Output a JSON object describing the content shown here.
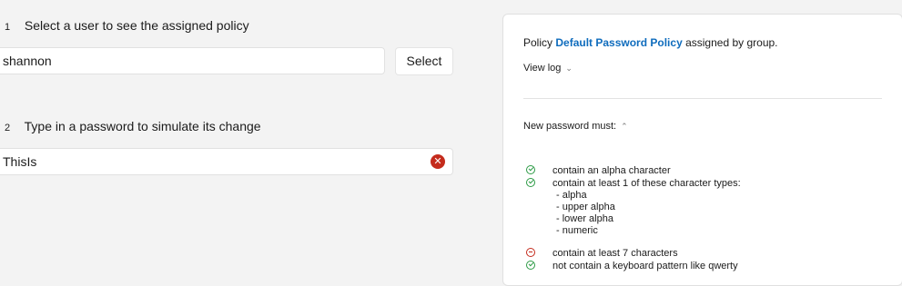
{
  "steps": {
    "one": {
      "num": "1",
      "label": "Select a user to see the assigned policy"
    },
    "two": {
      "num": "2",
      "label": "Type in a password to simulate its change"
    }
  },
  "user_field": {
    "value": "shannon"
  },
  "select_button": {
    "label": "Select"
  },
  "password_field": {
    "value": "ThisIs"
  },
  "panel": {
    "policy_prefix": "Policy",
    "policy_name": "Default Password Policy",
    "policy_suffix": "assigned by group.",
    "view_log": "View log",
    "new_password_must": "New password must:",
    "rules": [
      {
        "text": "contain an alpha character",
        "status": "pass"
      },
      {
        "text": "contain at least 1 of these character types:",
        "status": "pass"
      },
      {
        "text": "contain at least 7 characters",
        "status": "fail"
      },
      {
        "text": "not contain a keyboard pattern like qwerty",
        "status": "pass"
      }
    ],
    "char_types": [
      "- alpha",
      "- upper alpha",
      "- lower alpha",
      "- numeric"
    ]
  },
  "colors": {
    "link": "#0f6cbd",
    "pass": "#2c9a45",
    "fail": "#c42b1c"
  }
}
